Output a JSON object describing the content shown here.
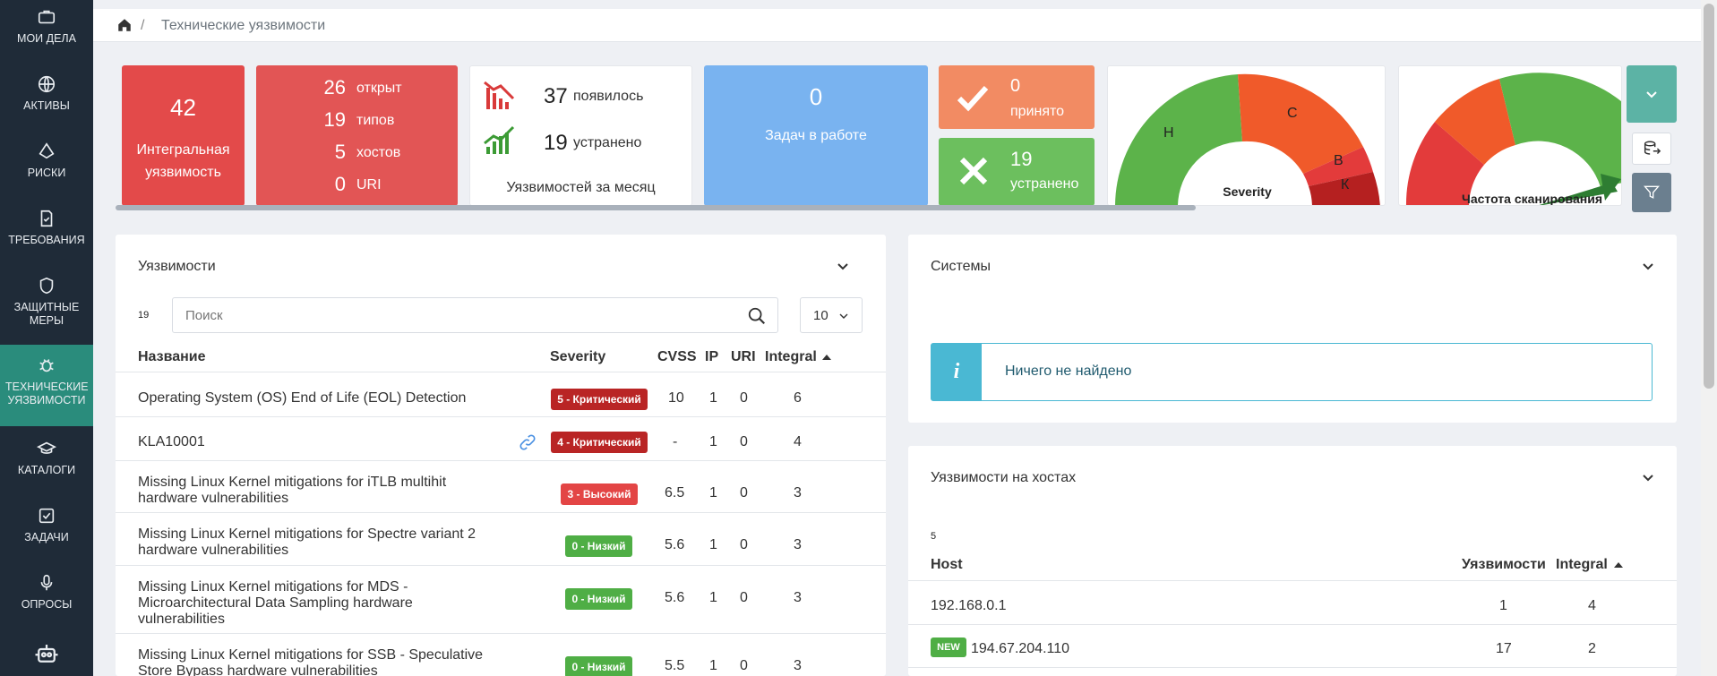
{
  "sidebar": {
    "items": [
      {
        "label": "МОИ ДЕЛА"
      },
      {
        "label": "АКТИВЫ"
      },
      {
        "label": "РИСКИ"
      },
      {
        "label": "ТРЕБОВАНИЯ"
      },
      {
        "label": "ЗАЩИТНЫЕ МЕРЫ"
      },
      {
        "label": "ТЕХНИЧЕСКИЕ УЯЗВИМОСТИ"
      },
      {
        "label": "КАТАЛОГИ"
      },
      {
        "label": "ЗАДАЧИ"
      },
      {
        "label": "ОПРОСЫ"
      }
    ]
  },
  "breadcrumb": {
    "separator": "/",
    "current": "Технические уязвимости"
  },
  "stats": {
    "integral": {
      "value": "42",
      "label": "Интегральная уязвимость"
    },
    "counts": [
      {
        "value": "26",
        "label": "открыт"
      },
      {
        "value": "19",
        "label": "типов"
      },
      {
        "value": "5",
        "label": "хостов"
      },
      {
        "value": "0",
        "label": "URI"
      }
    ],
    "monthly": {
      "appeared_value": "37",
      "appeared_label": "появилось",
      "fixed_value": "19",
      "fixed_label": "устранено",
      "caption": "Уязвимостей за месяц"
    },
    "tasks": {
      "value": "0",
      "label": "Задач в работе"
    },
    "accepted": {
      "value": "0",
      "label": "принято"
    },
    "resolved": {
      "value": "19",
      "label": "устранено"
    },
    "severity_gauge": {
      "title": "Severity",
      "labels": [
        "Н",
        "С",
        "В",
        "К"
      ]
    },
    "scan_gauge": {
      "title": "Частота сканирования"
    }
  },
  "colors": {
    "sidebar": "#1f2b38",
    "active": "#2a8c7c",
    "critical": "#b92525",
    "high": "#e34545",
    "low": "#4fae45",
    "info": "#4ab8d3"
  },
  "vulns_panel": {
    "title": "Уязвимости",
    "count": "19",
    "search_placeholder": "Поиск",
    "page_size": "10",
    "columns": {
      "name": "Название",
      "severity": "Severity",
      "cvss": "CVSS",
      "ip": "IP",
      "uri": "URI",
      "integral": "Integral"
    },
    "rows": [
      {
        "name": "Operating System (OS) End of Life (EOL) Detection",
        "severity": "5 - Критический",
        "cvss": "10",
        "ip": "1",
        "uri": "0",
        "integral": "6"
      },
      {
        "name": "KLA10001",
        "severity": "4 - Критический",
        "cvss": "-",
        "ip": "1",
        "uri": "0",
        "integral": "4"
      },
      {
        "name": "Missing Linux Kernel mitigations for iTLB multihit hardware vulnerabilities",
        "severity": "3 - Высокий",
        "cvss": "6.5",
        "ip": "1",
        "uri": "0",
        "integral": "3"
      },
      {
        "name": "Missing Linux Kernel mitigations for Spectre variant 2 hardware vulnerabilities",
        "severity": "0 - Низкий",
        "cvss": "5.6",
        "ip": "1",
        "uri": "0",
        "integral": "3"
      },
      {
        "name": "Missing Linux Kernel mitigations for MDS - Microarchitectural Data Sampling hardware vulnerabilities",
        "severity": "0 - Низкий",
        "cvss": "5.6",
        "ip": "1",
        "uri": "0",
        "integral": "3"
      },
      {
        "name": "Missing Linux Kernel mitigations for SSB - Speculative Store Bypass hardware vulnerabilities",
        "severity": "0 - Низкий",
        "cvss": "5.5",
        "ip": "1",
        "uri": "0",
        "integral": "3"
      }
    ]
  },
  "systems_panel": {
    "title": "Системы",
    "empty_message": "Ничего не найдено"
  },
  "hosts_panel": {
    "title": "Уязвимости на хостах",
    "count": "5",
    "columns": {
      "host": "Host",
      "vulns": "Уязвимости",
      "integral": "Integral"
    },
    "rows": [
      {
        "host": "192.168.0.1",
        "badge": "",
        "vulns": "1",
        "integral": "4"
      },
      {
        "host": "194.67.204.110",
        "badge": "NEW",
        "vulns": "17",
        "integral": "2"
      }
    ]
  }
}
